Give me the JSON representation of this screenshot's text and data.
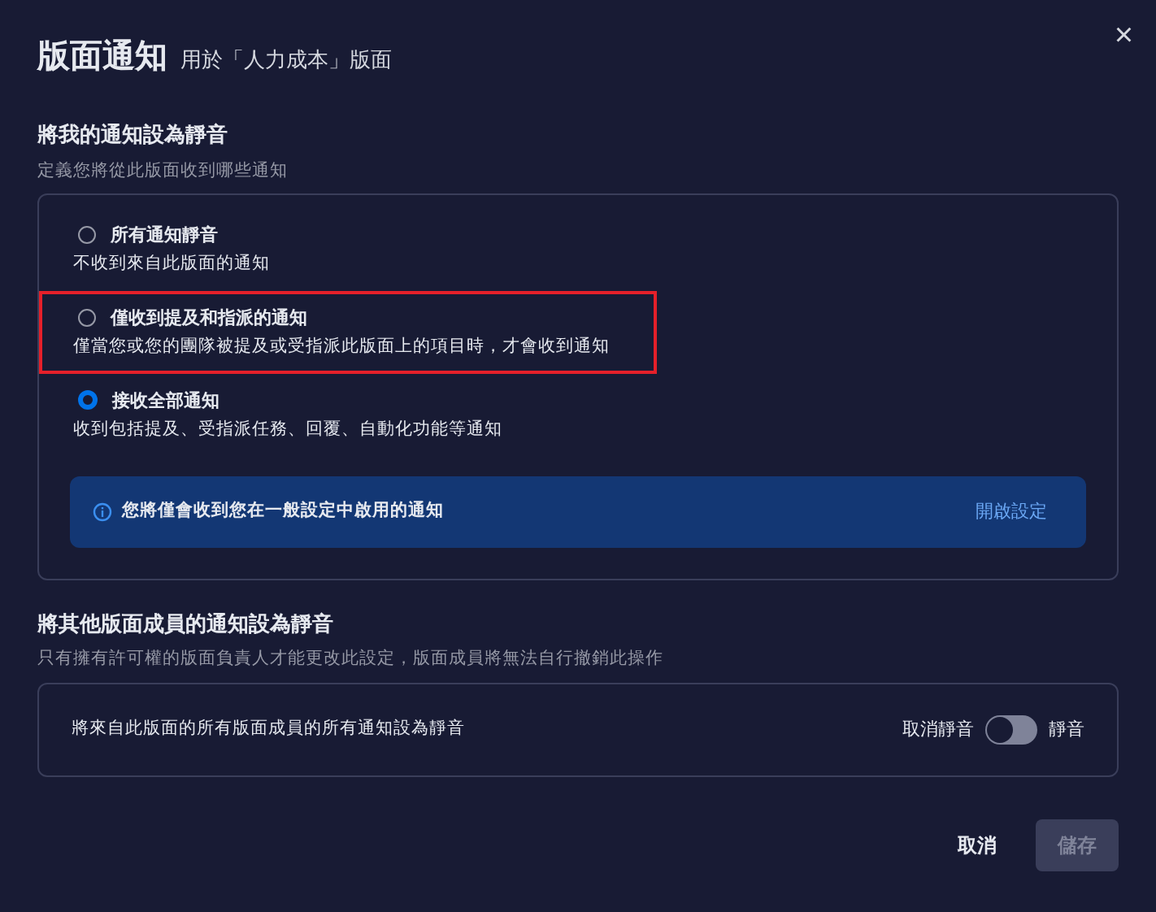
{
  "dialog": {
    "title": "版面通知",
    "subtitle": "用於「人力成本」版面",
    "close": "×"
  },
  "my_section": {
    "heading": "將我的通知設為靜音",
    "description": "定義您將從此版面收到哪些通知",
    "options": [
      {
        "label": "所有通知靜音",
        "description": "不收到來自此版面的通知",
        "selected": false,
        "highlighted": false
      },
      {
        "label": "僅收到提及和指派的通知",
        "description": "僅當您或您的團隊被提及或受指派此版面上的項目時，才會收到通知",
        "selected": false,
        "highlighted": true
      },
      {
        "label": "接收全部通知",
        "description": "收到包括提及、受指派任務、回覆、自動化功能等通知",
        "selected": true,
        "highlighted": false
      }
    ],
    "info": {
      "text": "您將僅會收到您在一般設定中啟用的通知",
      "link": "開啟設定"
    }
  },
  "members_section": {
    "heading": "將其他版面成員的通知設為靜音",
    "description": "只有擁有許可權的版面負責人才能更改此設定，版面成員將無法自行撤銷此操作",
    "row": {
      "label": "將來自此版面的所有版面成員的所有通知設為靜音",
      "off_label": "取消靜音",
      "on_label": "靜音",
      "on": false
    }
  },
  "buttons": {
    "cancel": "取消",
    "save": "儲存",
    "save_disabled": true
  }
}
